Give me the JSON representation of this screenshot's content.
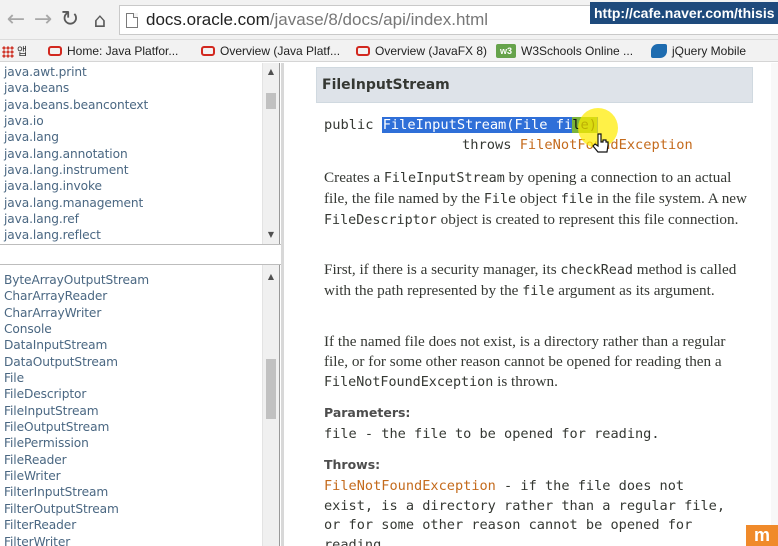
{
  "browser": {
    "url_host": "docs.oracle.com",
    "url_path": "/javase/8/docs/api/index.html",
    "status_link": "http://cafe.naver.com/thisis",
    "bookmarks": [
      {
        "label": "Home: Java Platfor...",
        "icon": "oracle-icon"
      },
      {
        "label": "Overview (Java Platf...",
        "icon": "oracle-icon"
      },
      {
        "label": "Overview (JavaFX 8)",
        "icon": "oracle-icon"
      },
      {
        "label": "W3Schools Online ...",
        "icon": "w3schools-icon"
      },
      {
        "label": "jQuery Mobile",
        "icon": "jquery-icon"
      }
    ],
    "bookmark_ko": "앱"
  },
  "packages": [
    "java.awt.print",
    "java.beans",
    "java.beans.beancontext",
    "java.io",
    "java.lang",
    "java.lang.annotation",
    "java.lang.instrument",
    "java.lang.invoke",
    "java.lang.management",
    "java.lang.ref",
    "java.lang.reflect"
  ],
  "classes": [
    "ByteArrayOutputStream",
    "CharArrayReader",
    "CharArrayWriter",
    "Console",
    "DataInputStream",
    "DataOutputStream",
    "File",
    "FileDescriptor",
    "FileInputStream",
    "FileOutputStream",
    "FilePermission",
    "FileReader",
    "FileWriter",
    "FilterInputStream",
    "FilterOutputStream",
    "FilterReader",
    "FilterWriter"
  ],
  "doc": {
    "heading": "FileInputStream",
    "sig_prefix": "public ",
    "sig_name": "FileInputStream(File fi",
    "sig_name2": "le)",
    "sig_throws": "throws ",
    "sig_exc": "FileNotFoundException",
    "para1": {
      "t1": "Creates a ",
      "c1": "FileInputStream",
      "t2": " by opening a connection to an actual file, the file named by the ",
      "c2": "File",
      "t3": " object ",
      "c3": "file",
      "t4": " in the file system. A new ",
      "c4": "FileDescriptor",
      "t5": " object is created to represent this file connection."
    },
    "para2": {
      "t1": "First, if there is a security manager, its ",
      "c1": "checkRead",
      "t2": " method is called with the path represented by the ",
      "c2": "file",
      "t3": " argument as its argument."
    },
    "para3": {
      "t1": "If the named file does not exist, is a directory rather than a regular file, or for some other reason cannot be opened for reading then a ",
      "c1": "FileNotFoundException",
      "t2": " is thrown."
    },
    "params_label": "Parameters:",
    "param_line": "file - the file to be opened for reading.",
    "throws_label": "Throws:",
    "throws_exc": "FileNotFoundException",
    "throws_text1": " - if the file does not",
    "throws_text2": "exist, is a directory rather than a regular file,",
    "throws_text3": "or for some other reason cannot be opened for",
    "throws_text4": "reading."
  },
  "corner_logo": "m"
}
